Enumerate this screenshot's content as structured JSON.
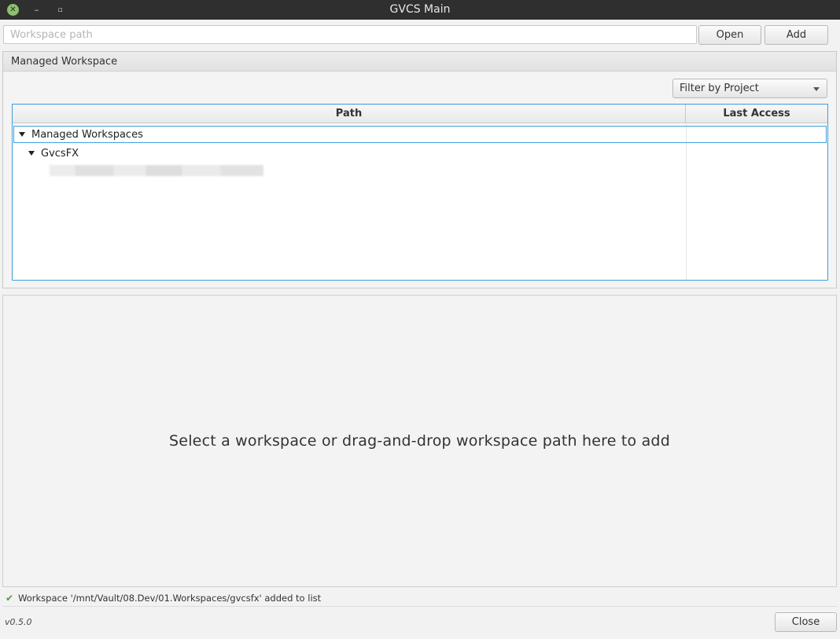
{
  "window": {
    "title": "GVCS Main",
    "controls": {
      "close_icon": "close-icon",
      "minimize_icon": "minimize-icon",
      "maximize_icon": "maximize-icon"
    }
  },
  "toolbar": {
    "path_placeholder": "Workspace path",
    "path_value": "",
    "open_label": "Open",
    "add_label": "Add"
  },
  "managed_panel": {
    "title": "Managed Workspace",
    "filter_label": "Filter by Project",
    "columns": [
      "Path",
      "Last Access"
    ],
    "tree": {
      "root": "Managed Workspaces",
      "project": "GvcsFX"
    }
  },
  "drop_area": {
    "message": "Select a workspace or drag-and-drop workspace path here to add"
  },
  "status": {
    "icon": "check-icon",
    "message": "Workspace '/mnt/Vault/08.Dev/01.Workspaces/gvcsfx' added to list"
  },
  "footer": {
    "version": "v0.5.0",
    "close_label": "Close"
  },
  "colors": {
    "accent": "#3a9fdc",
    "titlebar": "#2f2f2f",
    "success": "#4a9f3a"
  }
}
